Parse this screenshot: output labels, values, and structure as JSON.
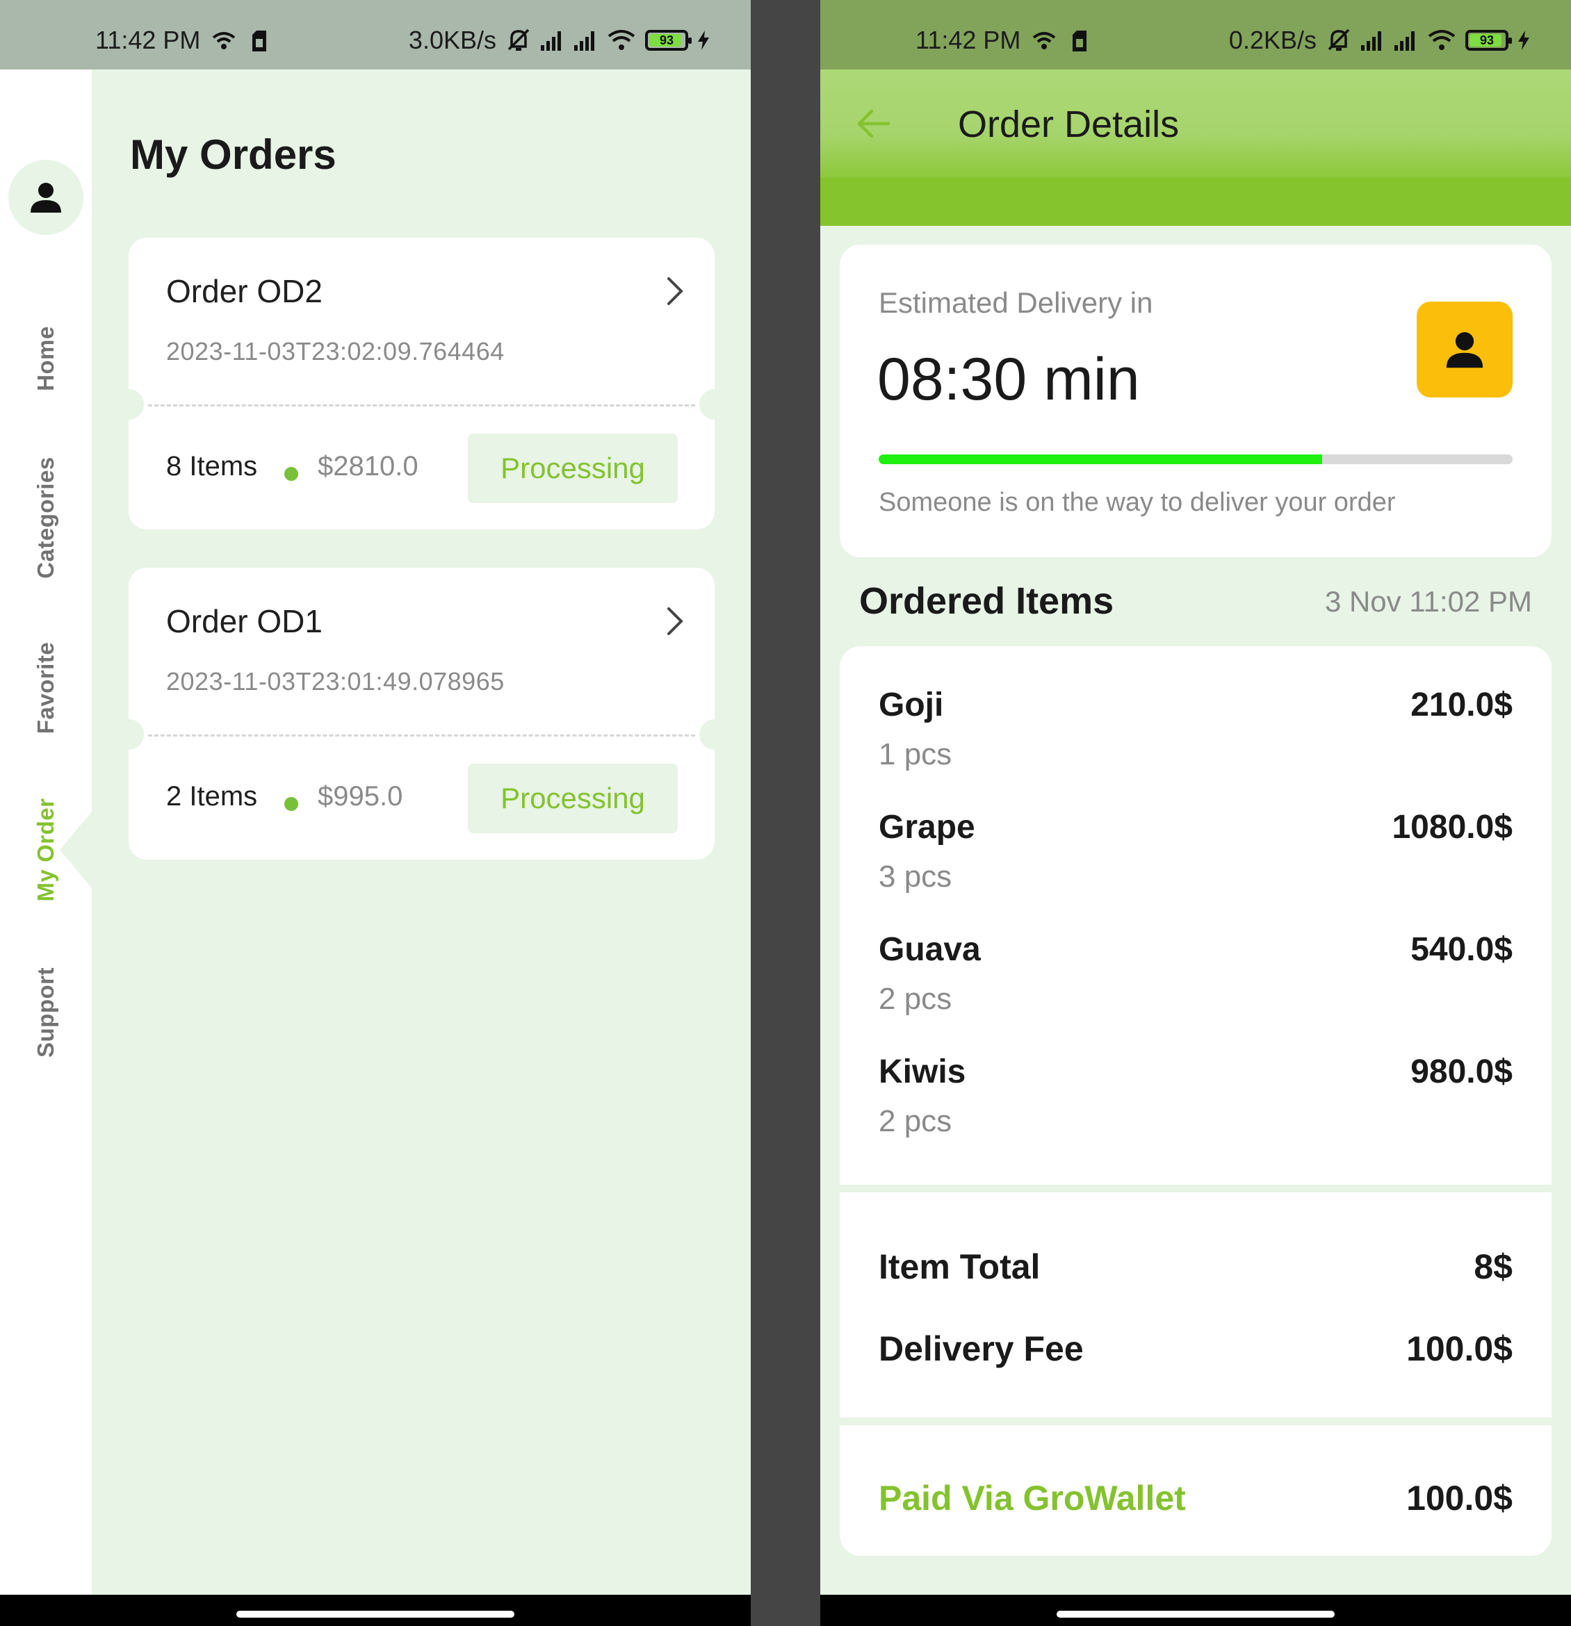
{
  "left_screen": {
    "status_bar": {
      "time": "11:42 PM",
      "speed": "3.0KB/s",
      "battery": "93",
      "battery_level": 0.93
    },
    "side_nav": {
      "items": [
        {
          "label": "Home",
          "active": false
        },
        {
          "label": "Categories",
          "active": false
        },
        {
          "label": "Favorite",
          "active": false
        },
        {
          "label": "My Order",
          "active": true
        },
        {
          "label": "Support",
          "active": false
        }
      ]
    },
    "title": "My Orders",
    "orders": [
      {
        "name": "Order OD2",
        "date": "2023-11-03T23:02:09.764464",
        "items": "8 Items",
        "price": "$2810.0",
        "status": "Processing"
      },
      {
        "name": "Order OD1",
        "date": "2023-11-03T23:01:49.078965",
        "items": "2 Items",
        "price": "$995.0",
        "status": "Processing"
      }
    ]
  },
  "right_screen": {
    "status_bar": {
      "time": "11:42 PM",
      "speed": "0.2KB/s",
      "battery": "93",
      "battery_level": 0.93
    },
    "title": "Order Details",
    "delivery": {
      "label": "Estimated Delivery in",
      "time": "08:30 min",
      "progress": 0.7,
      "note": "Someone is on the way to deliver your order"
    },
    "ordered_items": {
      "title": "Ordered Items",
      "date": "3 Nov 11:02 PM",
      "items": [
        {
          "name": "Goji",
          "qty": "1 pcs",
          "price": "210.0$"
        },
        {
          "name": "Grape",
          "qty": "3 pcs",
          "price": "1080.0$"
        },
        {
          "name": "Guava",
          "qty": "2 pcs",
          "price": "540.0$"
        },
        {
          "name": "Kiwis",
          "qty": "2 pcs",
          "price": "980.0$"
        }
      ]
    },
    "totals": {
      "item_total_label": "Item Total",
      "item_total": "8$",
      "delivery_fee_label": "Delivery Fee",
      "delivery_fee": "100.0$"
    },
    "payment": {
      "label": "Paid Via GroWallet",
      "amount": "100.0$"
    }
  },
  "colors": {
    "accent_green": "#84c22e",
    "background_mint": "#e7f4e6",
    "progress_green": "#1ef00f",
    "courier_yellow": "#fbbf0b",
    "text_dark": "#1a1a1a",
    "text_muted": "#8a8a8a"
  },
  "icons": [
    "wifi-icon",
    "sim-icon",
    "mute-icon",
    "signal-icon",
    "battery-icon",
    "charging-icon",
    "person-icon",
    "chevron-right-icon",
    "back-arrow-icon"
  ]
}
